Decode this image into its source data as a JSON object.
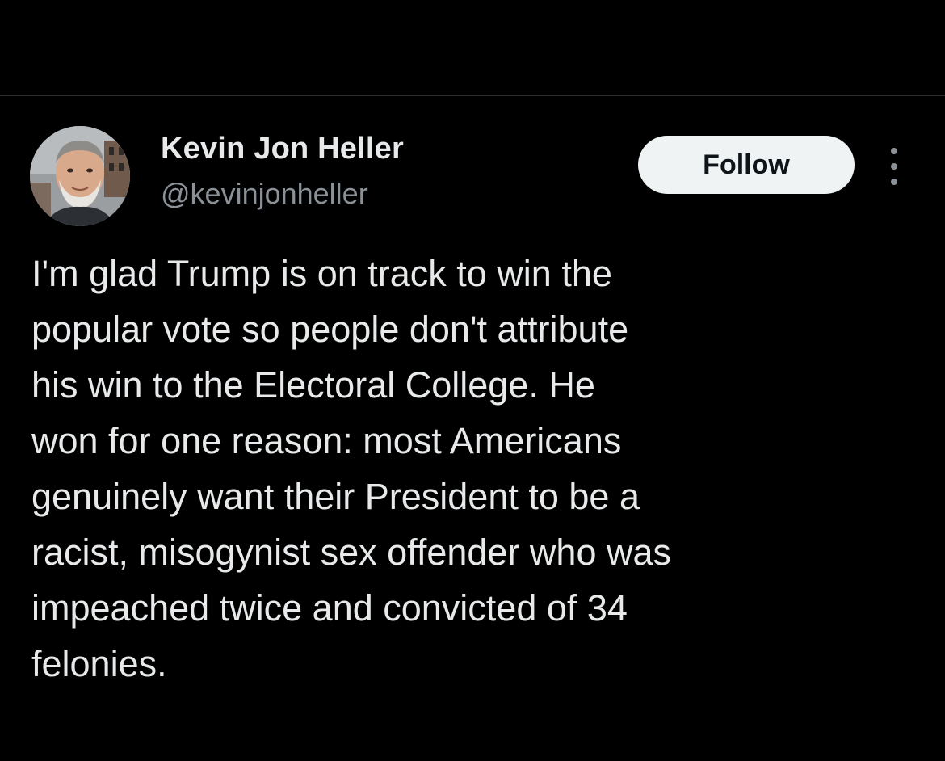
{
  "author": {
    "name": "Kevin Jon Heller",
    "handle": "@kevinjonheller",
    "avatar_icon": "profile-photo"
  },
  "actions": {
    "follow_label": "Follow",
    "more_icon": "more-vertical-icon"
  },
  "tweet": {
    "text": "I'm glad Trump is on track to win the\npopular vote so people don't attribute\nhis win to the Electoral College. He\nwon for one reason: most Americans\ngenuinely want their President to be a\nracist, misogynist sex offender who was\nimpeached twice and convicted of 34\nfelonies."
  },
  "colors": {
    "background": "#000000",
    "text_primary": "#e7e9ea",
    "text_secondary": "#8b9196",
    "follow_bg": "#eff3f4",
    "follow_text": "#0f1419"
  }
}
